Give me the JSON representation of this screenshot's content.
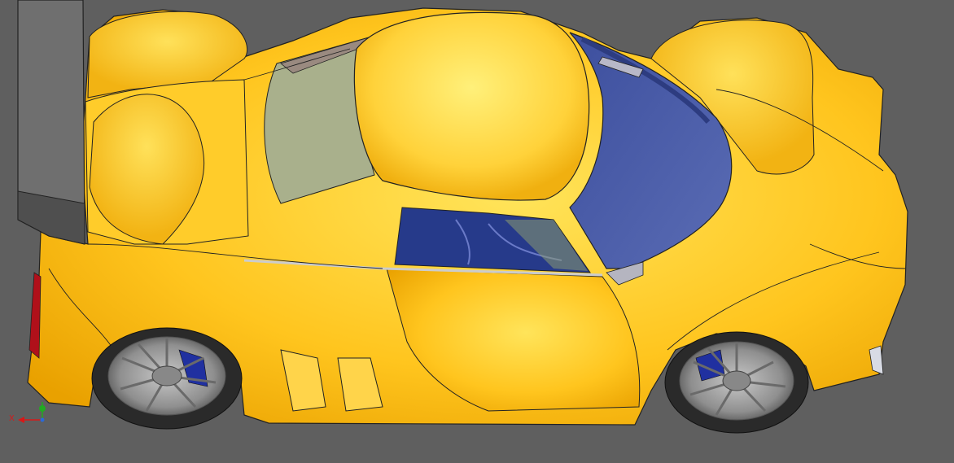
{
  "viewport": {
    "background": "#5f5f5f"
  },
  "model": {
    "body_color": "#ffc21a",
    "body_highlight": "#ffe25a",
    "body_shadow": "#e8a000",
    "glass_color": "#4a5ca8",
    "side_glass_color": "#a8b08a",
    "rear_glass_color": "#9a8a80",
    "edge_color": "#222222",
    "tire_color": "#2a2a2a",
    "rim_color": "#9a9a9a",
    "caliper_color": "#2030a0",
    "wing_color": "#6e6e6e",
    "taillight_color": "#b0101a"
  },
  "triad": {
    "x_label": "X",
    "x_color": "#d81818",
    "y_color": "#22aa22"
  }
}
